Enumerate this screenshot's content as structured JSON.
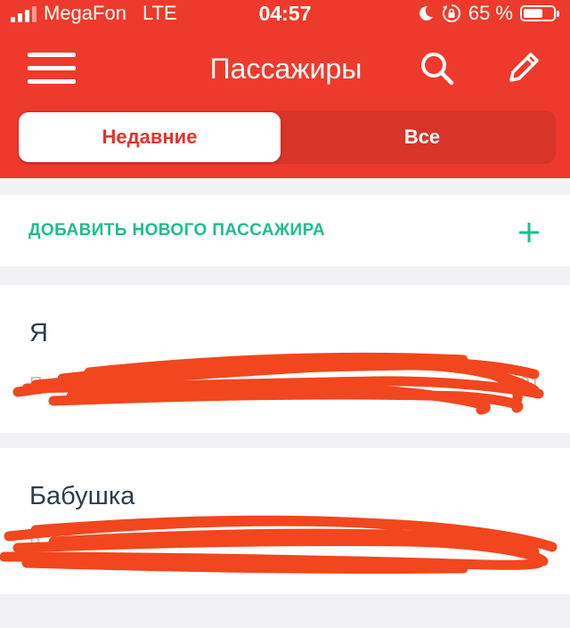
{
  "status_bar": {
    "carrier": "MegaFon",
    "network": "LTE",
    "time": "04:57",
    "battery_percent": "65 %",
    "battery_level": 0.65,
    "icons": [
      "signal-icon",
      "moon-icon",
      "rotation-lock-icon",
      "battery-icon"
    ]
  },
  "header": {
    "title": "Пассажиры",
    "background": "#ee3a2c",
    "icons": [
      "menu-icon",
      "search-icon",
      "edit-icon"
    ]
  },
  "tabs": [
    {
      "label": "Недавние",
      "active": true
    },
    {
      "label": "Все",
      "active": false
    }
  ],
  "add_passenger": {
    "label": "ДОБАВИТЬ НОВОГО ПАССАЖИРА",
    "accent": "#1bbf8e",
    "icon": "plus-icon"
  },
  "passengers": [
    {
      "name": "Я",
      "details_left": "Пр",
      "details_right": "1991"
    },
    {
      "name": "Бабушка",
      "details_left": "В",
      "details_right": ""
    }
  ]
}
